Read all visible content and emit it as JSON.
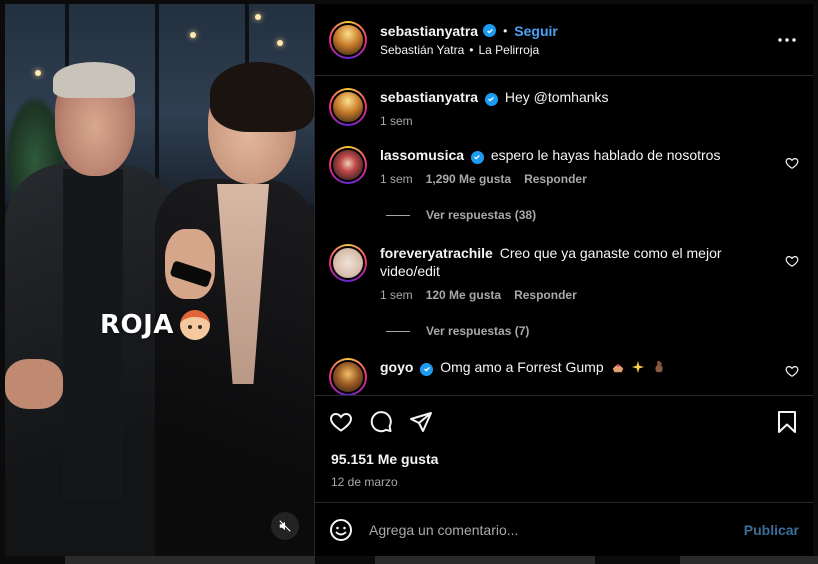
{
  "post": {
    "author": {
      "username": "sebastianyatra",
      "follow_label": "Seguir",
      "separator": "•"
    },
    "subtitle": {
      "left": "Sebastián Yatra",
      "separator": "•",
      "right": "La Pelirroja"
    },
    "media": {
      "caption": "ROJA",
      "caption_emoji": "red-haired-woman-emoji",
      "mute_icon": "speaker-muted-icon"
    },
    "caption": {
      "username": "sebastianyatra",
      "text": "Hey @tomhanks",
      "time": "1 sem"
    }
  },
  "comments": [
    {
      "username": "lassomusica",
      "verified": true,
      "text": "espero le hayas hablado de nosotros",
      "time": "1 sem",
      "likes": "1,290 Me gusta",
      "reply": "Responder",
      "replies": "Ver respuestas (38)"
    },
    {
      "username": "foreveryatrachile",
      "verified": false,
      "text": "Creo que ya ganaste como el mejor video/edit",
      "time": "1 sem",
      "likes": "120 Me gusta",
      "reply": "Responder",
      "replies": "Ver respuestas (7)"
    },
    {
      "username": "goyo",
      "verified": true,
      "text": "Omg amo a Forrest Gump",
      "emojis": [
        "hands-heart-emoji",
        "sparkles-emoji",
        "crossed-fingers-emoji"
      ]
    }
  ],
  "actions": {
    "like_icon": "heart-icon",
    "comment_icon": "comment-icon",
    "share_icon": "send-icon",
    "save_icon": "bookmark-icon"
  },
  "stats": {
    "likes": "95.151 Me gusta",
    "date": "12 de marzo"
  },
  "add_comment": {
    "placeholder": "Agrega un comentario...",
    "publish": "Publicar"
  },
  "colors": {
    "accent": "#4aa3f7",
    "verified": "#1d9bf0",
    "muted_text": "#a8a8a8",
    "publish": "#3b6d99"
  }
}
